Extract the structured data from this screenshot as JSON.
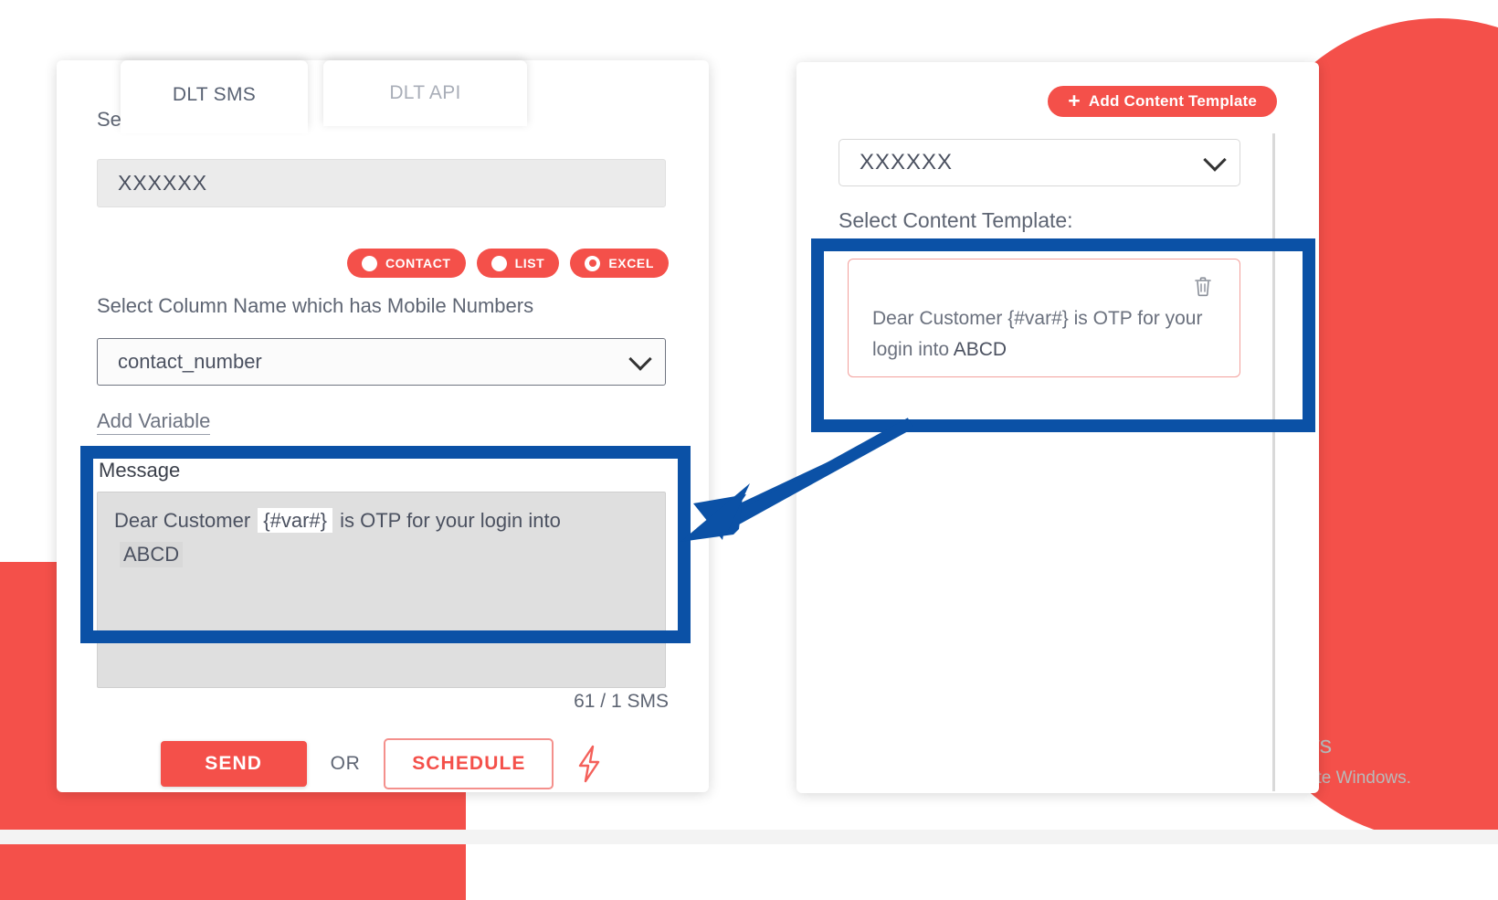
{
  "theme": {
    "accent_red": "#f4504a",
    "annotation_blue": "#0b51a6",
    "text_gray": "#5e6573"
  },
  "left_panel": {
    "tabs": [
      {
        "label": "DLT SMS",
        "active": true
      },
      {
        "label": "DLT API",
        "active": false
      }
    ],
    "sender_id": {
      "label": "Sender ID",
      "value": "XXXXXX"
    },
    "source_options": [
      {
        "label": "CONTACT",
        "selected": false
      },
      {
        "label": "LIST",
        "selected": false
      },
      {
        "label": "EXCEL",
        "selected": true
      }
    ],
    "column_select": {
      "label": "Select Column Name which has Mobile Numbers",
      "value": "contact_number"
    },
    "add_variable_link": "Add Variable",
    "message": {
      "label": "Message",
      "text_before_var": "Dear Customer ",
      "variable": "{#var#}",
      "text_after_var": "  is OTP for your login into ",
      "line2": "ABCD"
    },
    "sms_counter": "61 / 1 SMS",
    "actions": {
      "send_label": "SEND",
      "or_label": "OR",
      "schedule_label": "SCHEDULE",
      "bolt_icon": "lightning-bolt-icon"
    }
  },
  "right_panel": {
    "add_content_template_button": "Add Content Template",
    "add_icon": "plus-icon",
    "sender_select_value": "XXXXXX",
    "select_content_template_label": "Select Content Template:",
    "templates": [
      {
        "text_before_var": "Dear Customer ",
        "variable": "{#var#}",
        "text_after_var": " is OTP for your login into ",
        "suffix": "ABCD",
        "delete_icon": "trash-icon"
      }
    ]
  },
  "watermark": {
    "title": "Activate Windows",
    "subtitle": "Go to Settings to activate Windows."
  }
}
